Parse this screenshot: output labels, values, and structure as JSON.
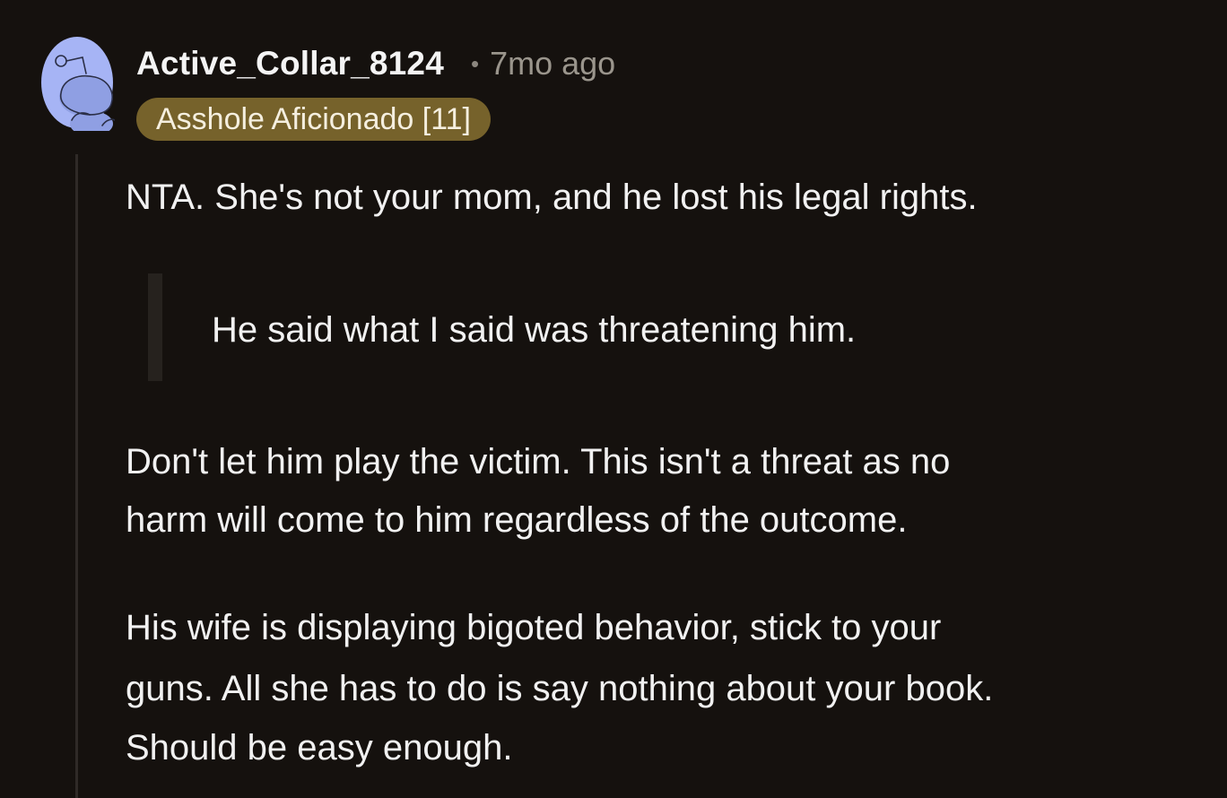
{
  "comment": {
    "author": "Active_Collar_8124",
    "separator": "•",
    "timestamp": "7mo ago",
    "flair": "Asshole Aficionado [11]",
    "flair_color": "#76622b",
    "avatar_icon": "snoo-avatar-icon",
    "paragraph_1": "NTA. She's not your mom, and he lost his legal rights.",
    "quote": "He said what I said was threatening him.",
    "paragraph_2_lines": [
      "Don't let him play the victim. This isn't a threat as no",
      "harm will come to him regardless of the outcome."
    ],
    "paragraph_3_lines": [
      "His wife is displaying bigoted behavior, stick to your",
      "guns. All she has to do is say nothing about your book.",
      "Should be easy enough."
    ]
  },
  "colors": {
    "background": "#15110e",
    "text": "#f1f1f1",
    "muted": "#9a958c",
    "avatar_bg": "#aab8ff",
    "thread_line": "#2f2a27"
  }
}
